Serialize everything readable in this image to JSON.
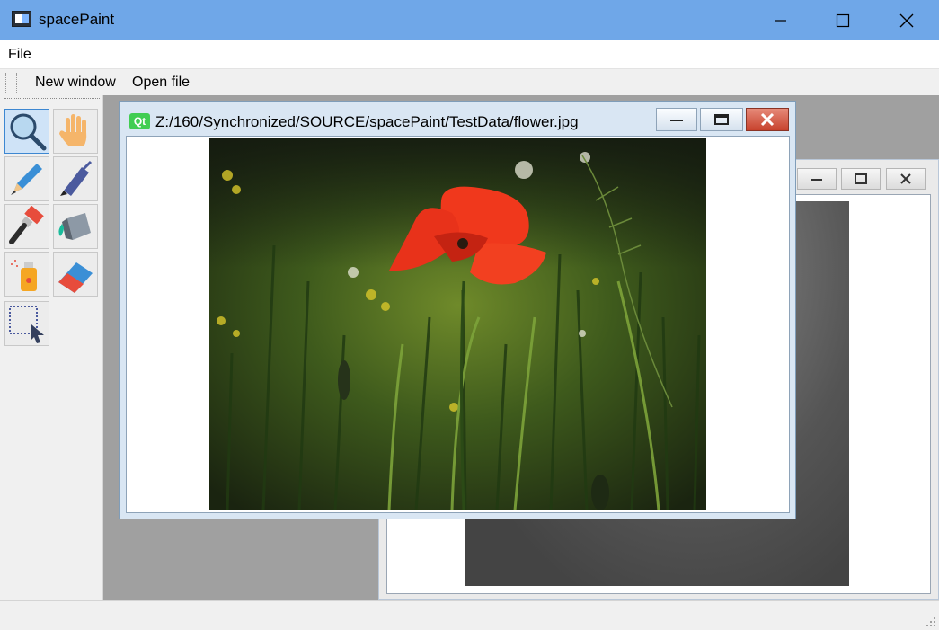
{
  "app": {
    "title": "spacePaint",
    "icon": "app-window-icon"
  },
  "window_controls": {
    "minimize": "minimize-icon",
    "maximize": "maximize-icon",
    "close": "close-icon"
  },
  "menu": {
    "items": [
      {
        "label": "File"
      }
    ]
  },
  "toolbar": {
    "buttons": [
      {
        "label": "New window"
      },
      {
        "label": "Open file"
      }
    ]
  },
  "tools": [
    {
      "name": "zoom-tool",
      "icon": "magnifier-icon",
      "active": true
    },
    {
      "name": "pan-tool",
      "icon": "hand-icon",
      "active": false
    },
    {
      "name": "pencil-tool",
      "icon": "pencil-icon",
      "active": false
    },
    {
      "name": "pen-tool",
      "icon": "pen-icon",
      "active": false
    },
    {
      "name": "brush-tool",
      "icon": "paint-brush-icon",
      "active": false
    },
    {
      "name": "fill-tool",
      "icon": "paint-bucket-icon",
      "active": false
    },
    {
      "name": "spray-tool",
      "icon": "spray-can-icon",
      "active": false
    },
    {
      "name": "eraser-tool",
      "icon": "eraser-icon",
      "active": false
    },
    {
      "name": "select-tool",
      "icon": "selection-arrow-icon",
      "active": false
    }
  ],
  "subwindows": {
    "front": {
      "title": "Z:/160/Synchronized/SOURCE/spacePaint/TestData/flower.jpg",
      "badge": "Qt",
      "image": "poppy-flower-photo"
    },
    "back": {
      "image": "grey-clouds-photo"
    }
  },
  "colors": {
    "titlebar": "#6fa7e8",
    "qt_badge": "#41cd52",
    "close_button": "#c7412c",
    "mdi_background": "#a0a0a0"
  }
}
